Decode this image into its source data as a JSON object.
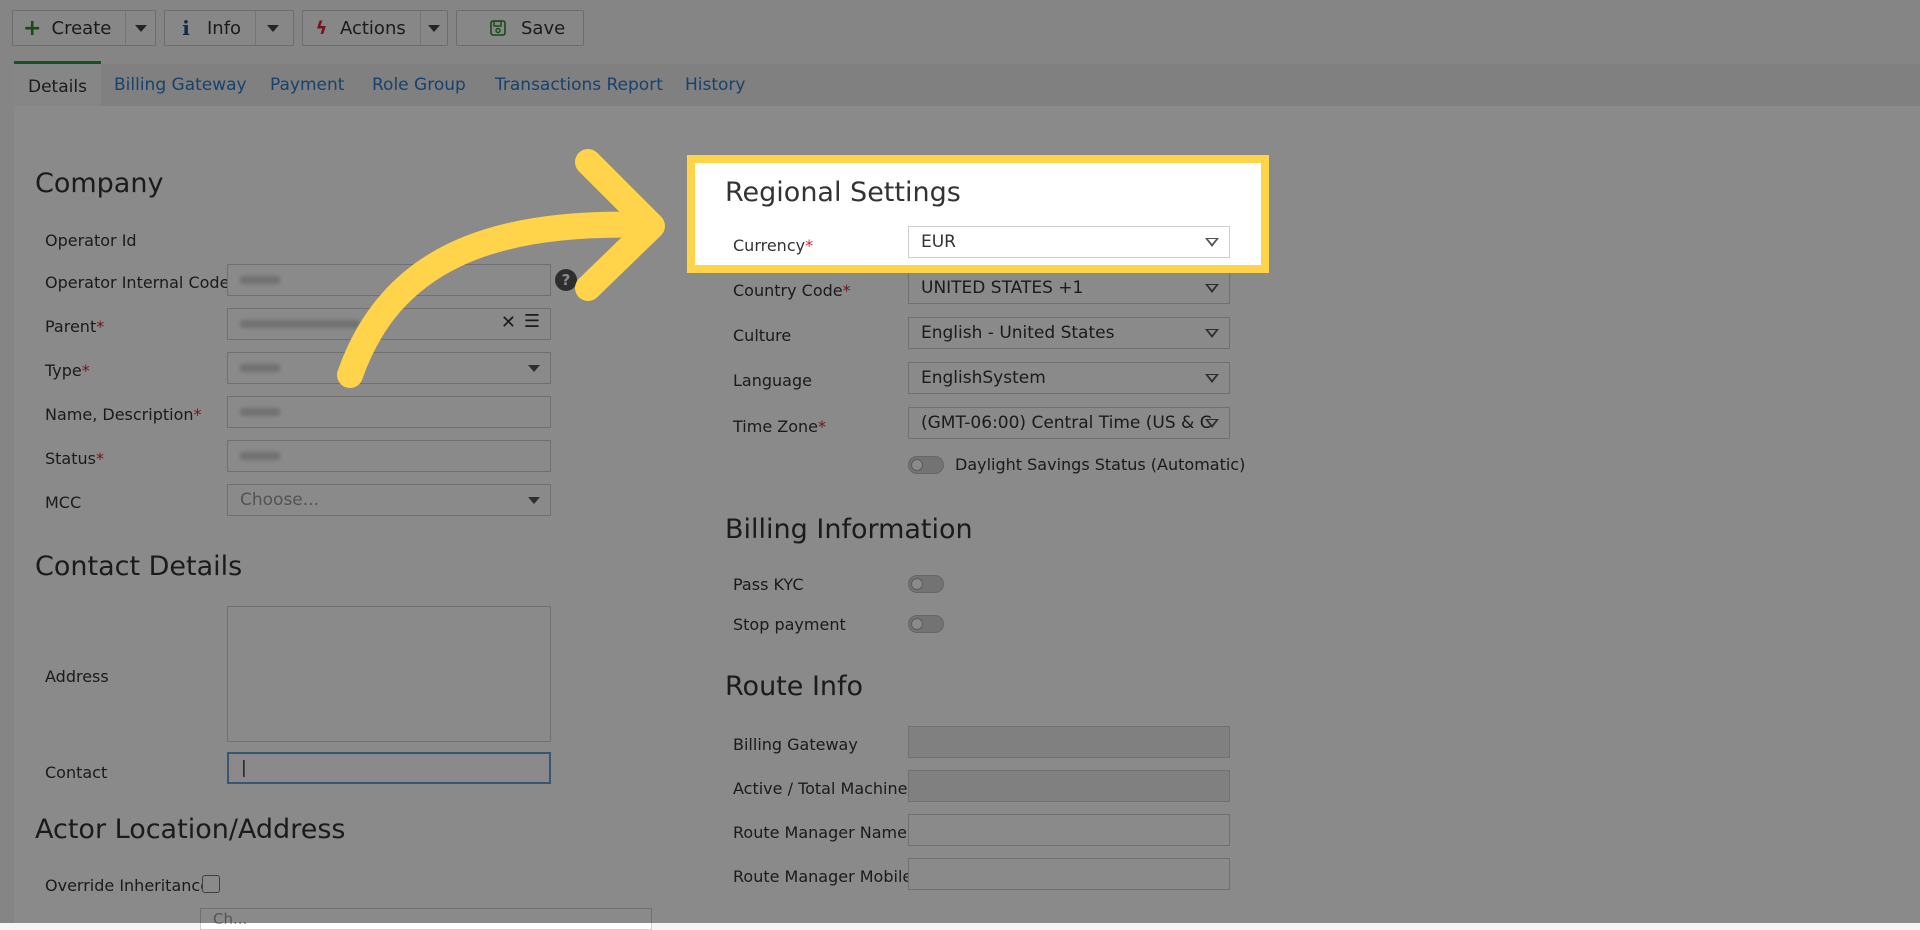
{
  "toolbar": {
    "create_label": "Create",
    "info_label": "Info",
    "actions_label": "Actions",
    "save_label": "Save"
  },
  "tabs": [
    {
      "label": "Details"
    },
    {
      "label": "Billing Gateway"
    },
    {
      "label": "Payment"
    },
    {
      "label": "Role Group"
    },
    {
      "label": "Transactions Report"
    },
    {
      "label": "History"
    }
  ],
  "company": {
    "title": "Company",
    "operator_id_label": "Operator Id",
    "operator_internal_code_label": "Operator Internal Code",
    "parent_label": "Parent",
    "type_label": "Type",
    "name_description_label": "Name, Description",
    "status_label": "Status",
    "mcc_label": "MCC",
    "mcc_placeholder": "Choose..."
  },
  "contact_details": {
    "title": "Contact Details",
    "address_label": "Address",
    "contact_label": "Contact",
    "contact_value": "|"
  },
  "actor_location": {
    "title": "Actor Location/Address",
    "override_label": "Override Inheritance",
    "choose_placeholder": "Ch..."
  },
  "regional": {
    "title": "Regional Settings",
    "currency_label": "Currency",
    "currency_value": "EUR",
    "country_code_label": "Country Code",
    "country_code_value": "UNITED STATES +1",
    "culture_label": "Culture",
    "culture_value": "English - United States",
    "language_label": "Language",
    "language_value": "EnglishSystem",
    "time_zone_label": "Time Zone",
    "time_zone_value": "(GMT-06:00) Central Time (US & C",
    "daylight_label": "Daylight Savings Status (Automatic)"
  },
  "billing": {
    "title": "Billing Information",
    "pass_kyc_label": "Pass KYC",
    "stop_payment_label": "Stop payment"
  },
  "route": {
    "title": "Route Info",
    "billing_gateway_label": "Billing Gateway",
    "active_machines_label": "Active / Total Machines",
    "manager_name_label": "Route Manager Name",
    "manager_mobile_label": "Route Manager Mobile"
  },
  "required_mark": "*",
  "colors": {
    "accent_link": "#2a7ac9",
    "highlight_border": "#ffd44a",
    "arrow": "#ffd44a",
    "active_tab": "#2a9a3a",
    "required": "#d9232e"
  }
}
